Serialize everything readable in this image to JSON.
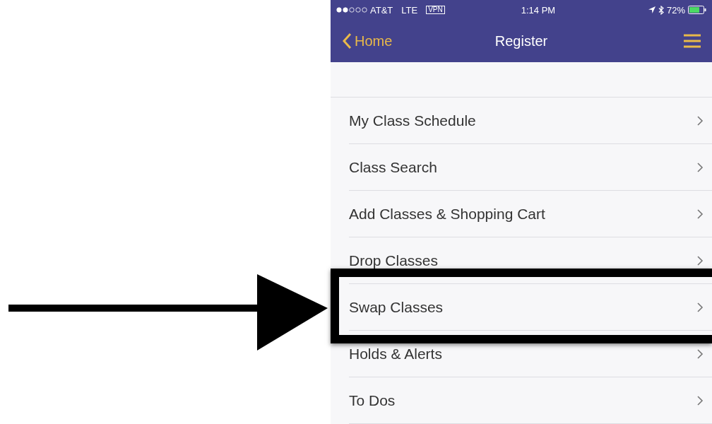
{
  "status_bar": {
    "carrier": "AT&T",
    "network": "LTE",
    "vpn": "VPN",
    "time": "1:14 PM",
    "battery": "72%"
  },
  "nav": {
    "back": "Home",
    "title": "Register"
  },
  "menu": [
    {
      "label": "My Class Schedule",
      "highlighted": false
    },
    {
      "label": "Class Search",
      "highlighted": false
    },
    {
      "label": "Add Classes & Shopping Cart",
      "highlighted": false
    },
    {
      "label": "Drop Classes",
      "highlighted": false
    },
    {
      "label": "Swap Classes",
      "highlighted": true
    },
    {
      "label": "Holds & Alerts",
      "highlighted": false
    },
    {
      "label": "To Dos",
      "highlighted": false
    }
  ]
}
